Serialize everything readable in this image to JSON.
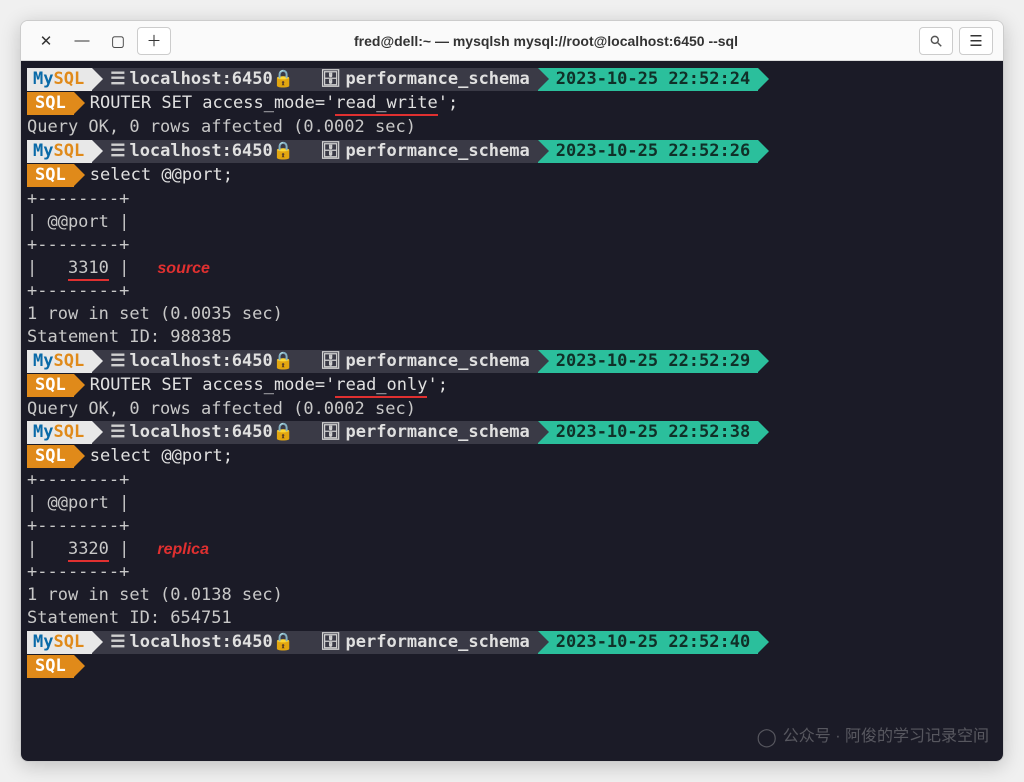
{
  "window": {
    "title": "fred@dell:~ — mysqlsh mysql://root@localhost:6450 --sql"
  },
  "prompt": {
    "mysql_my": "My",
    "mysql_sql": "SQL",
    "host": "localhost:6450",
    "schema": "performance_schema",
    "sql_label": "SQL"
  },
  "blocks": [
    {
      "time": "2023-10-25 22:52:24",
      "cmd_pre": "ROUTER SET access_mode='",
      "cmd_ul": "read_write",
      "cmd_post": "';",
      "result": [
        "Query OK, 0 rows affected (0.0002 sec)"
      ]
    },
    {
      "time": "2023-10-25 22:52:26",
      "cmd_pre": "select @@port;",
      "cmd_ul": "",
      "cmd_post": "",
      "table_header": "| @@port |",
      "table_sep": "+--------+",
      "table_val": "3310",
      "annotation": "source",
      "result": [
        "1 row in set (0.0035 sec)",
        "Statement ID: 988385"
      ]
    },
    {
      "time": "2023-10-25 22:52:29",
      "cmd_pre": "ROUTER SET access_mode='",
      "cmd_ul": "read_only",
      "cmd_post": "';",
      "result": [
        "Query OK, 0 rows affected (0.0002 sec)"
      ]
    },
    {
      "time": "2023-10-25 22:52:38",
      "cmd_pre": "select @@port;",
      "cmd_ul": "",
      "cmd_post": "",
      "table_header": "| @@port |",
      "table_sep": "+--------+",
      "table_val": "3320",
      "annotation": "replica",
      "result": [
        "1 row in set (0.0138 sec)",
        "Statement ID: 654751"
      ]
    },
    {
      "time": "2023-10-25 22:52:40",
      "cmd_pre": "",
      "cmd_ul": "",
      "cmd_post": ""
    }
  ],
  "watermark": "公众号 · 阿俊的学习记录空间"
}
